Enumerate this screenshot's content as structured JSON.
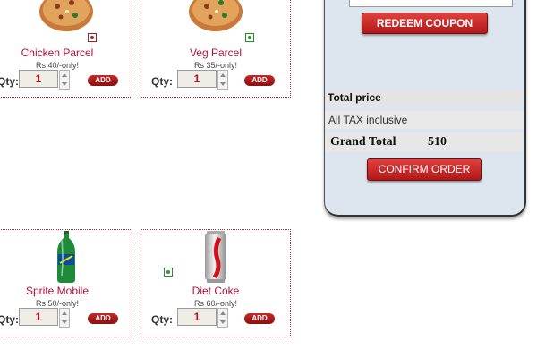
{
  "products": [
    {
      "name": "Chicken Parcel",
      "price": "Rs 40/-only!",
      "qty_label": "Qty:",
      "qty": "1",
      "add_label": "ADD"
    },
    {
      "name": "Veg Parcel",
      "price": "Rs 35/-only!",
      "qty_label": "Qty:",
      "qty": "1",
      "add_label": "ADD"
    },
    {
      "name": "Sprite Mobile",
      "price": "Rs 50/-only!",
      "qty_label": "Qty:",
      "qty": "1",
      "add_label": "ADD"
    },
    {
      "name": "Diet Coke",
      "price": "Rs 60/-only!",
      "qty_label": "Qty:",
      "qty": "1",
      "add_label": "ADD"
    }
  ],
  "cart": {
    "redeem_label": "REDEEM COUPON",
    "total_price_label": "Total price",
    "tax_note": "All TAX inclusive",
    "grand_total_label": "Grand Total",
    "grand_total_value": "510",
    "confirm_label": "CONFIRM ORDER"
  },
  "colors": {
    "accent": "#b0103a",
    "button": "#c42a2a",
    "panel": "#dde6ee"
  }
}
